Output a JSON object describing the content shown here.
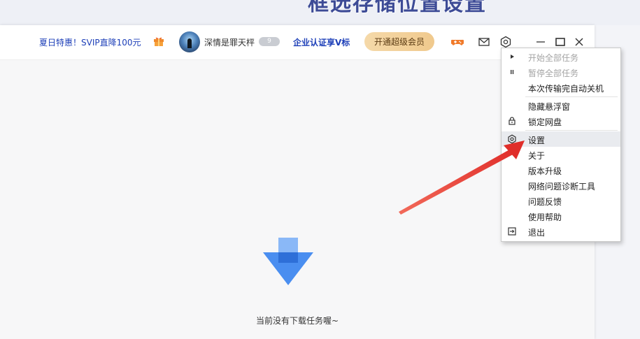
{
  "caption": "框选存储位置设置",
  "header": {
    "promo": "夏日特惠！SVIP直降100元",
    "username": "深情是罪天枰",
    "level_badge": "9",
    "enterprise_link": "企业认证享V标",
    "vip_button": "开通超级会员"
  },
  "empty_state": {
    "text": "当前没有下载任务喔~"
  },
  "colors": {
    "accent_blue": "#1d3fb8",
    "arrow_blue": "#4a8ef0",
    "annotation_red": "#e53a37",
    "vip_gold": "#f0c98d"
  },
  "menu": {
    "items": [
      {
        "label": "开始全部任务",
        "icon": "play-icon",
        "disabled": true
      },
      {
        "label": "暂停全部任务",
        "icon": "pause-icon",
        "disabled": true
      },
      {
        "label": "本次传输完自动关机",
        "icon": "",
        "disabled": false
      },
      {
        "label": "隐藏悬浮窗",
        "icon": "",
        "disabled": false
      },
      {
        "label": "锁定网盘",
        "icon": "lock-icon",
        "disabled": false
      },
      {
        "label": "设置",
        "icon": "gear-icon",
        "disabled": false,
        "highlighted": true
      },
      {
        "label": "关于",
        "icon": "",
        "disabled": false
      },
      {
        "label": "版本升级",
        "icon": "",
        "disabled": false
      },
      {
        "label": "网络问题诊断工具",
        "icon": "",
        "disabled": false
      },
      {
        "label": "问题反馈",
        "icon": "",
        "disabled": false
      },
      {
        "label": "使用帮助",
        "icon": "",
        "disabled": false
      },
      {
        "label": "退出",
        "icon": "exit-icon",
        "disabled": false
      }
    ]
  }
}
